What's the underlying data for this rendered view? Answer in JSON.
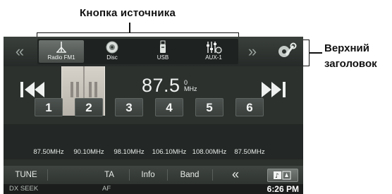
{
  "callouts": {
    "source_button": "Кнопка источника",
    "top_header_line1": "Верхний",
    "top_header_line2": "заголовок"
  },
  "topbar": {
    "left_arrow_icon": "double-chevron-left-icon",
    "right_arrow_icon": "double-chevron-right-icon",
    "sources": [
      {
        "label": "Radio FM1",
        "icon": "antenna-icon",
        "active": true
      },
      {
        "label": "Disc",
        "icon": "disc-icon",
        "active": false
      },
      {
        "label": "USB",
        "icon": "usb-stick-icon",
        "active": false
      },
      {
        "label": "AUX-1",
        "icon": "aux-sliders-icon",
        "active": false
      }
    ],
    "settings_icon": "wrench-icon"
  },
  "tuner": {
    "frequency": "87.5",
    "stereo_indicator": "0",
    "unit": "MHz"
  },
  "presets": [
    {
      "number": "1",
      "freq": "87.50MHz"
    },
    {
      "number": "2",
      "freq": "90.10MHz"
    },
    {
      "number": "3",
      "freq": "98.10MHz"
    },
    {
      "number": "4",
      "freq": "106.10MHz"
    },
    {
      "number": "5",
      "freq": "108.00MHz"
    },
    {
      "number": "6",
      "freq": "87.50MHz"
    }
  ],
  "bottombar": {
    "tune": "TUNE",
    "ta": "TA",
    "info": "Info",
    "band": "Band",
    "back_icon": "double-chevron-left-icon",
    "audio_icon": "audio-source-icon"
  },
  "status": {
    "left": "DX SEEK",
    "mid": "AF",
    "time": "6:26 PM"
  },
  "colors": {
    "screen_bg": "#2c312e",
    "active_source": "#5c625e",
    "text": "#eef1ef"
  }
}
